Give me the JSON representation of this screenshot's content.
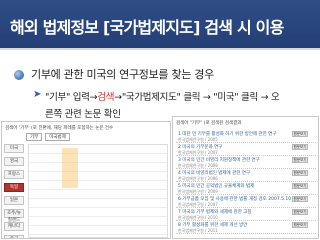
{
  "title": "해외 법제정보 [국가법제지도] 검색 시 이용",
  "heading": "기부에 관한 미국의 연구정보를 찾는 경우",
  "steps": {
    "arrow": "➤",
    "part1": "\"기부\" 입력→",
    "part2_keyword": "검색",
    "part3": "→\"국가법제지도\" 클릭 → \"미국\" 클릭 → 오",
    "line2": "른쪽 관련 논문 확인"
  },
  "left_panel": {
    "caption": "검색어 '기부' (로 전편에, 해당 파레를 포함하는 논문 건수",
    "tabs": [
      "기부",
      "미국법제"
    ],
    "sidebar": [
      "미국",
      "영국",
      "프랑스",
      "독일",
      "일본",
      "호주/뉴질랜드",
      "캐나다",
      "중국"
    ]
  },
  "right_panel": {
    "caption": "검색어 \"기부\" (로 검색된 검색결과",
    "rows": [
      {
        "title": "1 대한 민 기부를 활성화 하기 위한 방안에 관한 연구",
        "sub": "한국법제연구원 / 2005",
        "btn": "원문보기"
      },
      {
        "title": "2 미국의 기부문화 연구",
        "sub": "한국법제연구원 / 2007",
        "btn": "원문보기"
      },
      {
        "title": "3 미국의 민간 비영리 지원정책에 관한 연구",
        "sub": "한국법제연구원 / 2008",
        "btn": "원문보기"
      },
      {
        "title": "4 미국의 비영리법인 법제에 관한 연구",
        "sub": "한국법제연구원 / 2006",
        "btn": "원문보기"
      },
      {
        "title": "5 미국의 민간 공익법인 규율체계와 법제",
        "sub": "한국법제연구원 / 2009",
        "btn": "원문보기"
      },
      {
        "title": "6 기부금품 모집 및 사용에 관한 법률 개정 검토 2007.5.10",
        "sub": "한국법제연구원 / 2007",
        "btn": "원문보기"
      },
      {
        "title": "7 미국의 기부 법제와 세제에 관한 고찰",
        "sub": "한국법제연구원 / 2010",
        "btn": "원문보기"
      },
      {
        "title": "8 기부 활성화를 위한 세제 개선 방안",
        "sub": "한국법제연구원 / 2011",
        "btn": "원문보기"
      }
    ]
  }
}
